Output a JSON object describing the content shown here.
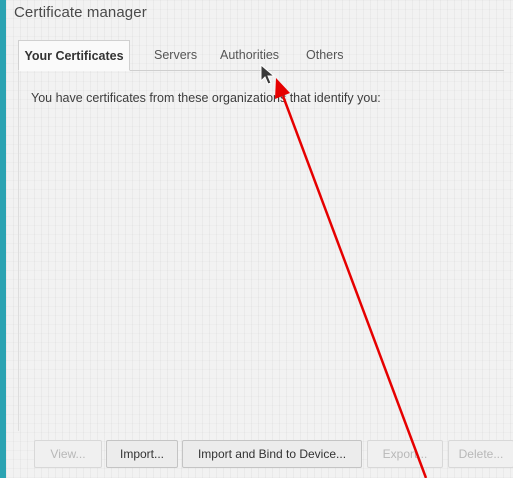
{
  "window": {
    "title": "Certificate manager"
  },
  "tabs": [
    {
      "label": "Your Certificates",
      "active": true
    },
    {
      "label": "Servers",
      "active": false
    },
    {
      "label": "Authorities",
      "active": false
    },
    {
      "label": "Others",
      "active": false
    }
  ],
  "main": {
    "description": "You have certificates from these organizations that identify you:"
  },
  "buttons": {
    "view": "View...",
    "import": "Import...",
    "import_bind": "Import and Bind to Device...",
    "export": "Export...",
    "delete": "Delete..."
  },
  "colors": {
    "background": "#2ba3b2",
    "annotation_arrow": "#e60000"
  }
}
